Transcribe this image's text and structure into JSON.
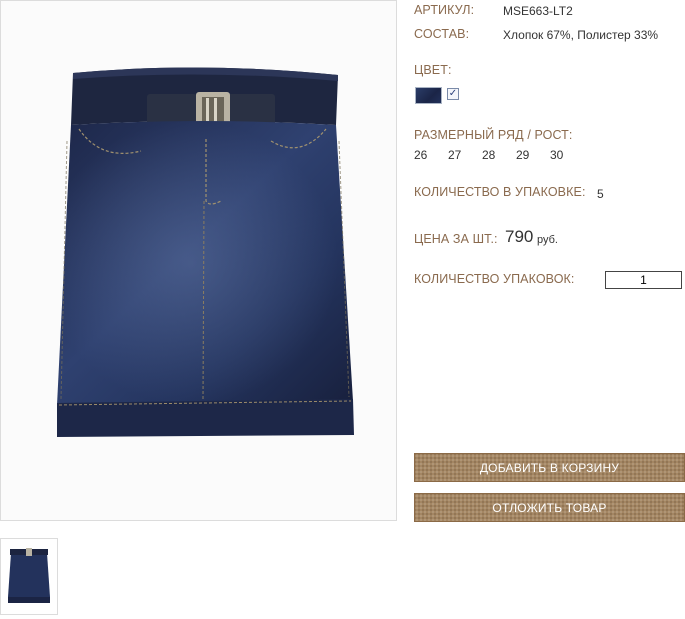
{
  "product": {
    "article_label": "АРТИКУЛ:",
    "article_value": "MSE663-LT2",
    "composition_label": "СОСТАВ:",
    "composition_value": "Хлопок 67%, Полистер 33%",
    "color_label": "ЦВЕТ:",
    "color_swatch": {
      "name": "dark-denim",
      "color": "#1f2b50",
      "selected": true,
      "check": "✓"
    },
    "sizes_label": "РАЗМЕРНЫЙ РЯД / РОСТ:",
    "sizes": [
      "26",
      "27",
      "28",
      "29",
      "30"
    ],
    "pack_qty_label": "КОЛИЧЕСТВО В УПАКОВКЕ:",
    "pack_qty_value": "5",
    "price_label": "ЦЕНА ЗА ШТ.:",
    "price_value": "790",
    "price_currency": "руб.",
    "packs_label": "КОЛИЧЕСТВО УПАКОВОК:",
    "packs_value": "1"
  },
  "actions": {
    "add_to_cart": "ДОБАВИТЬ В КОРЗИНУ",
    "defer": "ОТЛОЖИТЬ ТОВАР"
  },
  "images": {
    "main": "denim-skirt-photo",
    "thumbnails": [
      "denim-skirt-thumbnail"
    ]
  },
  "theme": {
    "label_color": "#8a6a4e",
    "button_color": "#a48663"
  }
}
